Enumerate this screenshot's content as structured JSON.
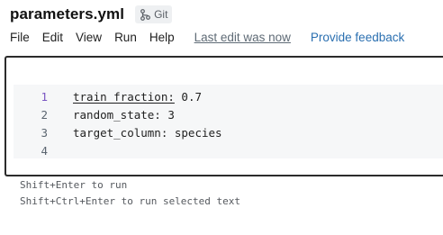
{
  "header": {
    "file_title": "parameters.yml",
    "git_label": "Git"
  },
  "menu": {
    "items": [
      "File",
      "Edit",
      "View",
      "Run",
      "Help"
    ],
    "last_edit": "Last edit was now",
    "feedback": "Provide feedback"
  },
  "editor": {
    "lines": [
      {
        "number": "1",
        "key": "train_fraction:",
        "value": " 0.7"
      },
      {
        "number": "2",
        "text": "random_state: 3"
      },
      {
        "number": "3",
        "text": "target_column: species"
      },
      {
        "number": "4",
        "text": ""
      }
    ]
  },
  "hints": {
    "run": "Shift+Enter to run",
    "run_selected": "Shift+Ctrl+Enter to run selected text"
  },
  "colors": {
    "accent_link": "#2a6fb0",
    "line_active": "#7a56c2"
  },
  "icons": {
    "git": "git-branch-icon"
  }
}
